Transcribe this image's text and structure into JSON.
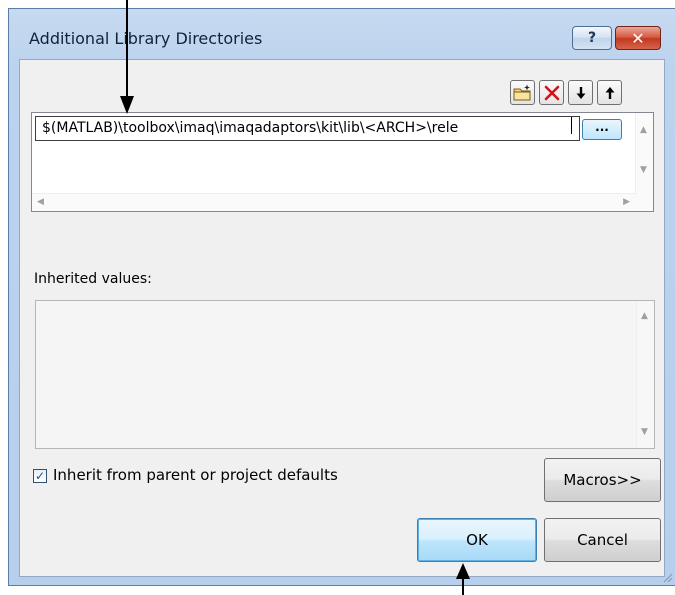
{
  "window": {
    "title": "Additional Library Directories",
    "help_label": "?",
    "close_label": "✕"
  },
  "toolbar": {
    "icons": [
      "new-folder-icon",
      "delete-icon",
      "move-down-icon",
      "move-up-icon"
    ]
  },
  "directories": {
    "current_value": "$(MATLAB)\\toolbox\\imaq\\imaqadaptors\\kit\\lib\\<ARCH>\\rele",
    "browse_label": "..."
  },
  "inherited": {
    "label": "Inherited values:"
  },
  "options": {
    "inherit_label": "Inherit from parent or project defaults",
    "inherit_checked": true
  },
  "buttons": {
    "macros_label": "Macros>>",
    "ok_label": "OK",
    "cancel_label": "Cancel"
  },
  "colors": {
    "accent": "#3c7fb1",
    "close_red": "#c1381f",
    "delete_red": "#d0141a"
  }
}
